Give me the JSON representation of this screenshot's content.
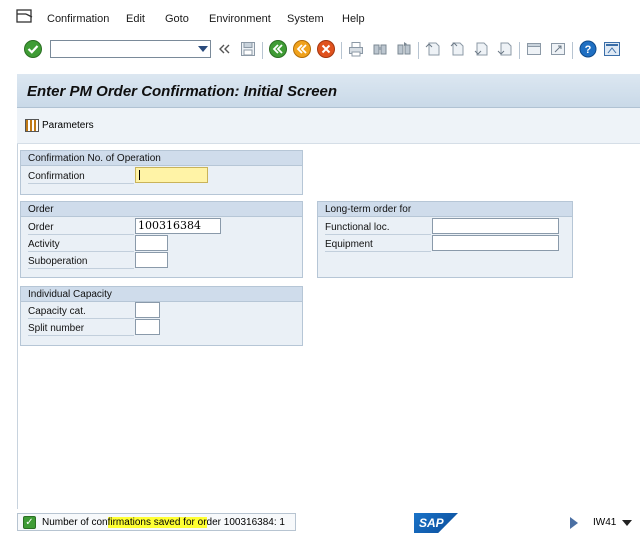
{
  "menu": {
    "items": [
      {
        "label": "Confirmation"
      },
      {
        "label": "Edit"
      },
      {
        "label": "Goto"
      },
      {
        "label": "Environment"
      },
      {
        "label": "System"
      },
      {
        "label": "Help"
      }
    ]
  },
  "toolbar": {
    "command_field_value": "",
    "icons": [
      "enter-icon",
      "back-double-arrow-icon",
      "save-icon",
      "back-icon",
      "exit-icon",
      "cancel-icon",
      "print-icon",
      "find-icon",
      "find-next-icon",
      "first-page-icon",
      "previous-page-icon",
      "next-page-icon",
      "last-page-icon",
      "new-session-icon",
      "shortcut-icon",
      "help-icon",
      "layout-icon"
    ]
  },
  "screen": {
    "title": "Enter PM Order Confirmation: Initial Screen",
    "parameters_label": "Parameters"
  },
  "groups": {
    "confirmation_no": {
      "title": "Confirmation No. of Operation",
      "confirmation_label": "Confirmation",
      "confirmation_value": ""
    },
    "order": {
      "title": "Order",
      "order_label": "Order",
      "order_value": "100316384",
      "activity_label": "Activity",
      "activity_value": "",
      "suboperation_label": "Suboperation",
      "suboperation_value": ""
    },
    "long_term": {
      "title": "Long-term order for",
      "functional_loc_label": "Functional loc.",
      "functional_loc_value": "",
      "equipment_label": "Equipment",
      "equipment_value": ""
    },
    "capacity": {
      "title": "Individual Capacity",
      "capacity_cat_label": "Capacity cat.",
      "capacity_cat_value": "",
      "split_number_label": "Split number",
      "split_number_value": ""
    }
  },
  "status": {
    "text_pre": "Number of con",
    "text_hl": "firmations saved for or",
    "text_post": "der 100316384: 1",
    "logo": "SAP",
    "transaction": "IW41"
  },
  "colors": {
    "accent": "#1a73c8",
    "required_field": "#fff3a6",
    "highlight": "#ffff33",
    "success": "#3f9c35"
  }
}
